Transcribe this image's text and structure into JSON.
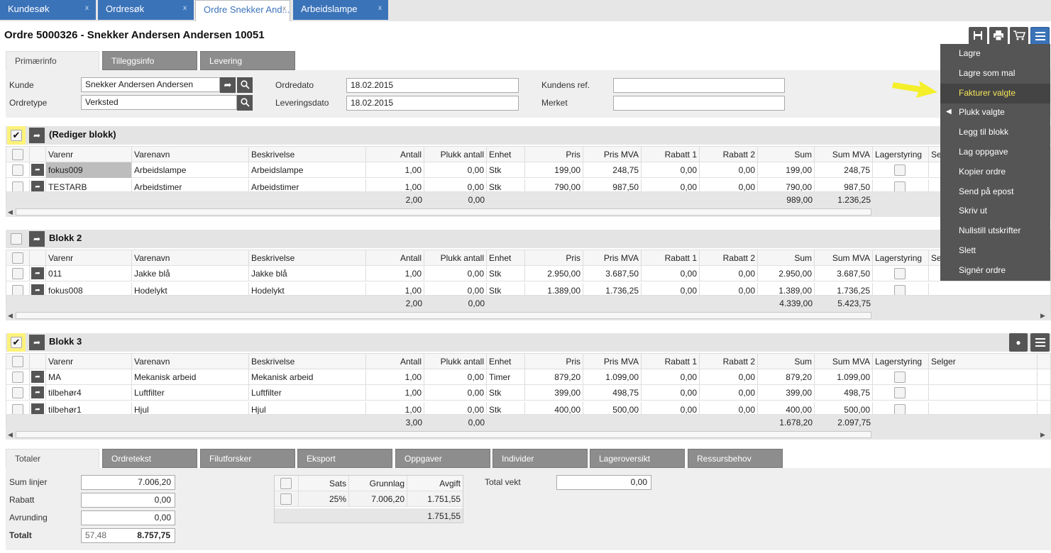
{
  "tabs": [
    {
      "label": "Kundesøk",
      "close": "x"
    },
    {
      "label": "Ordresøk",
      "close": "x"
    },
    {
      "label": "Ordre Snekker And...",
      "close": "x"
    },
    {
      "label": "Arbeidslampe",
      "close": "x"
    }
  ],
  "page_title": "Ordre 5000326 - Snekker Andersen Andersen 10051",
  "header_icons": [
    "save-icon",
    "print-icon",
    "cart-icon",
    "menu-icon"
  ],
  "sub_tabs": [
    "Primærinfo",
    "Tilleggsinfo",
    "Levering"
  ],
  "form": {
    "kunde_label": "Kunde",
    "kunde_value": "Snekker Andersen Andersen",
    "ordretype_label": "Ordretype",
    "ordretype_value": "Verksted",
    "ordredato_label": "Ordredato",
    "ordredato_value": "18.02.2015",
    "leveringsdato_label": "Leveringsdato",
    "leveringsdato_value": "18.02.2015",
    "kundens_ref_label": "Kundens ref.",
    "kundens_ref_value": "",
    "merket_label": "Merket",
    "merket_value": ""
  },
  "columns": [
    "Varenr",
    "Varenavn",
    "Beskrivelse",
    "Antall",
    "Plukk antall",
    "Enhet",
    "Pris",
    "Pris MVA",
    "Rabatt 1",
    "Rabatt 2",
    "Sum",
    "Sum MVA",
    "Lagerstyring",
    "Selger"
  ],
  "columns_block1_selger": "Sel",
  "columns_block2_selger": "Se",
  "blocks": [
    {
      "title": "(Rediger blokk)",
      "checked": true,
      "rows": [
        {
          "varenr": "fokus009",
          "varenavn": "Arbeidslampe",
          "beskrivelse": "Arbeidslampe",
          "antall": "1,00",
          "plukk": "0,00",
          "enhet": "Stk",
          "pris": "199,00",
          "prismva": "248,75",
          "rab1": "0,00",
          "rab2": "0,00",
          "sum": "199,00",
          "summva": "248,75"
        },
        {
          "varenr": "TESTARB",
          "varenavn": "Arbeidstimer",
          "beskrivelse": "Arbeidstimer",
          "antall": "1,00",
          "plukk": "0,00",
          "enhet": "Stk",
          "pris": "790,00",
          "prismva": "987,50",
          "rab1": "0,00",
          "rab2": "0,00",
          "sum": "790,00",
          "summva": "987,50"
        }
      ],
      "totals": {
        "antall": "2,00",
        "plukk": "0,00",
        "sum": "989,00",
        "summva": "1.236,25"
      }
    },
    {
      "title": "Blokk 2",
      "checked": false,
      "rows": [
        {
          "varenr": "011",
          "varenavn": "Jakke blå",
          "beskrivelse": "Jakke blå",
          "antall": "1,00",
          "plukk": "0,00",
          "enhet": "Stk",
          "pris": "2.950,00",
          "prismva": "3.687,50",
          "rab1": "0,00",
          "rab2": "0,00",
          "sum": "2.950,00",
          "summva": "3.687,50"
        },
        {
          "varenr": "fokus008",
          "varenavn": "Hodelykt",
          "beskrivelse": "Hodelykt",
          "antall": "1,00",
          "plukk": "0,00",
          "enhet": "Stk",
          "pris": "1.389,00",
          "prismva": "1.736,25",
          "rab1": "0,00",
          "rab2": "0,00",
          "sum": "1.389,00",
          "summva": "1.736,25"
        }
      ],
      "totals": {
        "antall": "2,00",
        "plukk": "0,00",
        "sum": "4.339,00",
        "summva": "5.423,75"
      }
    },
    {
      "title": "Blokk 3",
      "checked": true,
      "rows": [
        {
          "varenr": "MA",
          "varenavn": "Mekanisk arbeid",
          "beskrivelse": "Mekanisk arbeid",
          "antall": "1,00",
          "plukk": "0,00",
          "enhet": "Timer",
          "pris": "879,20",
          "prismva": "1.099,00",
          "rab1": "0,00",
          "rab2": "0,00",
          "sum": "879,20",
          "summva": "1.099,00"
        },
        {
          "varenr": "tilbehør4",
          "varenavn": "Luftfilter",
          "beskrivelse": "Luftfilter",
          "antall": "1,00",
          "plukk": "0,00",
          "enhet": "Stk",
          "pris": "399,00",
          "prismva": "498,75",
          "rab1": "0,00",
          "rab2": "0,00",
          "sum": "399,00",
          "summva": "498,75"
        },
        {
          "varenr": "tilbehør1",
          "varenavn": "Hjul",
          "beskrivelse": "Hjul",
          "antall": "1,00",
          "plukk": "0,00",
          "enhet": "Stk",
          "pris": "400,00",
          "prismva": "500,00",
          "rab1": "0,00",
          "rab2": "0,00",
          "sum": "400,00",
          "summva": "500,00"
        }
      ],
      "totals": {
        "antall": "3,00",
        "plukk": "0,00",
        "sum": "1.678,20",
        "summva": "2.097,75"
      }
    }
  ],
  "dropdown_menu": [
    {
      "label": "Lagre"
    },
    {
      "label": "Lagre som mal"
    },
    {
      "label": "Fakturer valgte",
      "selected": true
    },
    {
      "label": "Plukk valgte",
      "submenu": true
    },
    {
      "label": "Legg til blokk"
    },
    {
      "label": "Lag oppgave"
    },
    {
      "label": "Kopier ordre"
    },
    {
      "label": "Send på epost"
    },
    {
      "label": "Skriv ut"
    },
    {
      "label": "Nullstill utskrifter"
    },
    {
      "label": "Slett"
    },
    {
      "label": "Signér ordre"
    }
  ],
  "bottom_tabs": [
    "Totaler",
    "Ordretekst",
    "Filutforsker",
    "Eksport",
    "Oppgaver",
    "Individer",
    "Lageroversikt",
    "Ressursbehov"
  ],
  "totals": {
    "sum_linjer_label": "Sum linjer",
    "sum_linjer": "7.006,20",
    "rabatt_label": "Rabatt",
    "rabatt": "0,00",
    "avrunding_label": "Avrunding",
    "avrunding": "0,00",
    "totalt_label": "Totalt",
    "totalt_small": "57,48",
    "totalt": "8.757,75",
    "total_vekt_label": "Total vekt",
    "total_vekt": "0,00"
  },
  "mva": {
    "headers": [
      "Sats",
      "Grunnlag",
      "Avgift"
    ],
    "row": {
      "sats": "25%",
      "grunnlag": "7.006,20",
      "avgift": "1.751,55"
    },
    "total": "1.751,55"
  },
  "colors": {
    "tab_blue": "#3b73b9",
    "menu_bg": "#555555",
    "highlight": "#f5e55a",
    "checkbox_highlight": "#fdf27a"
  }
}
